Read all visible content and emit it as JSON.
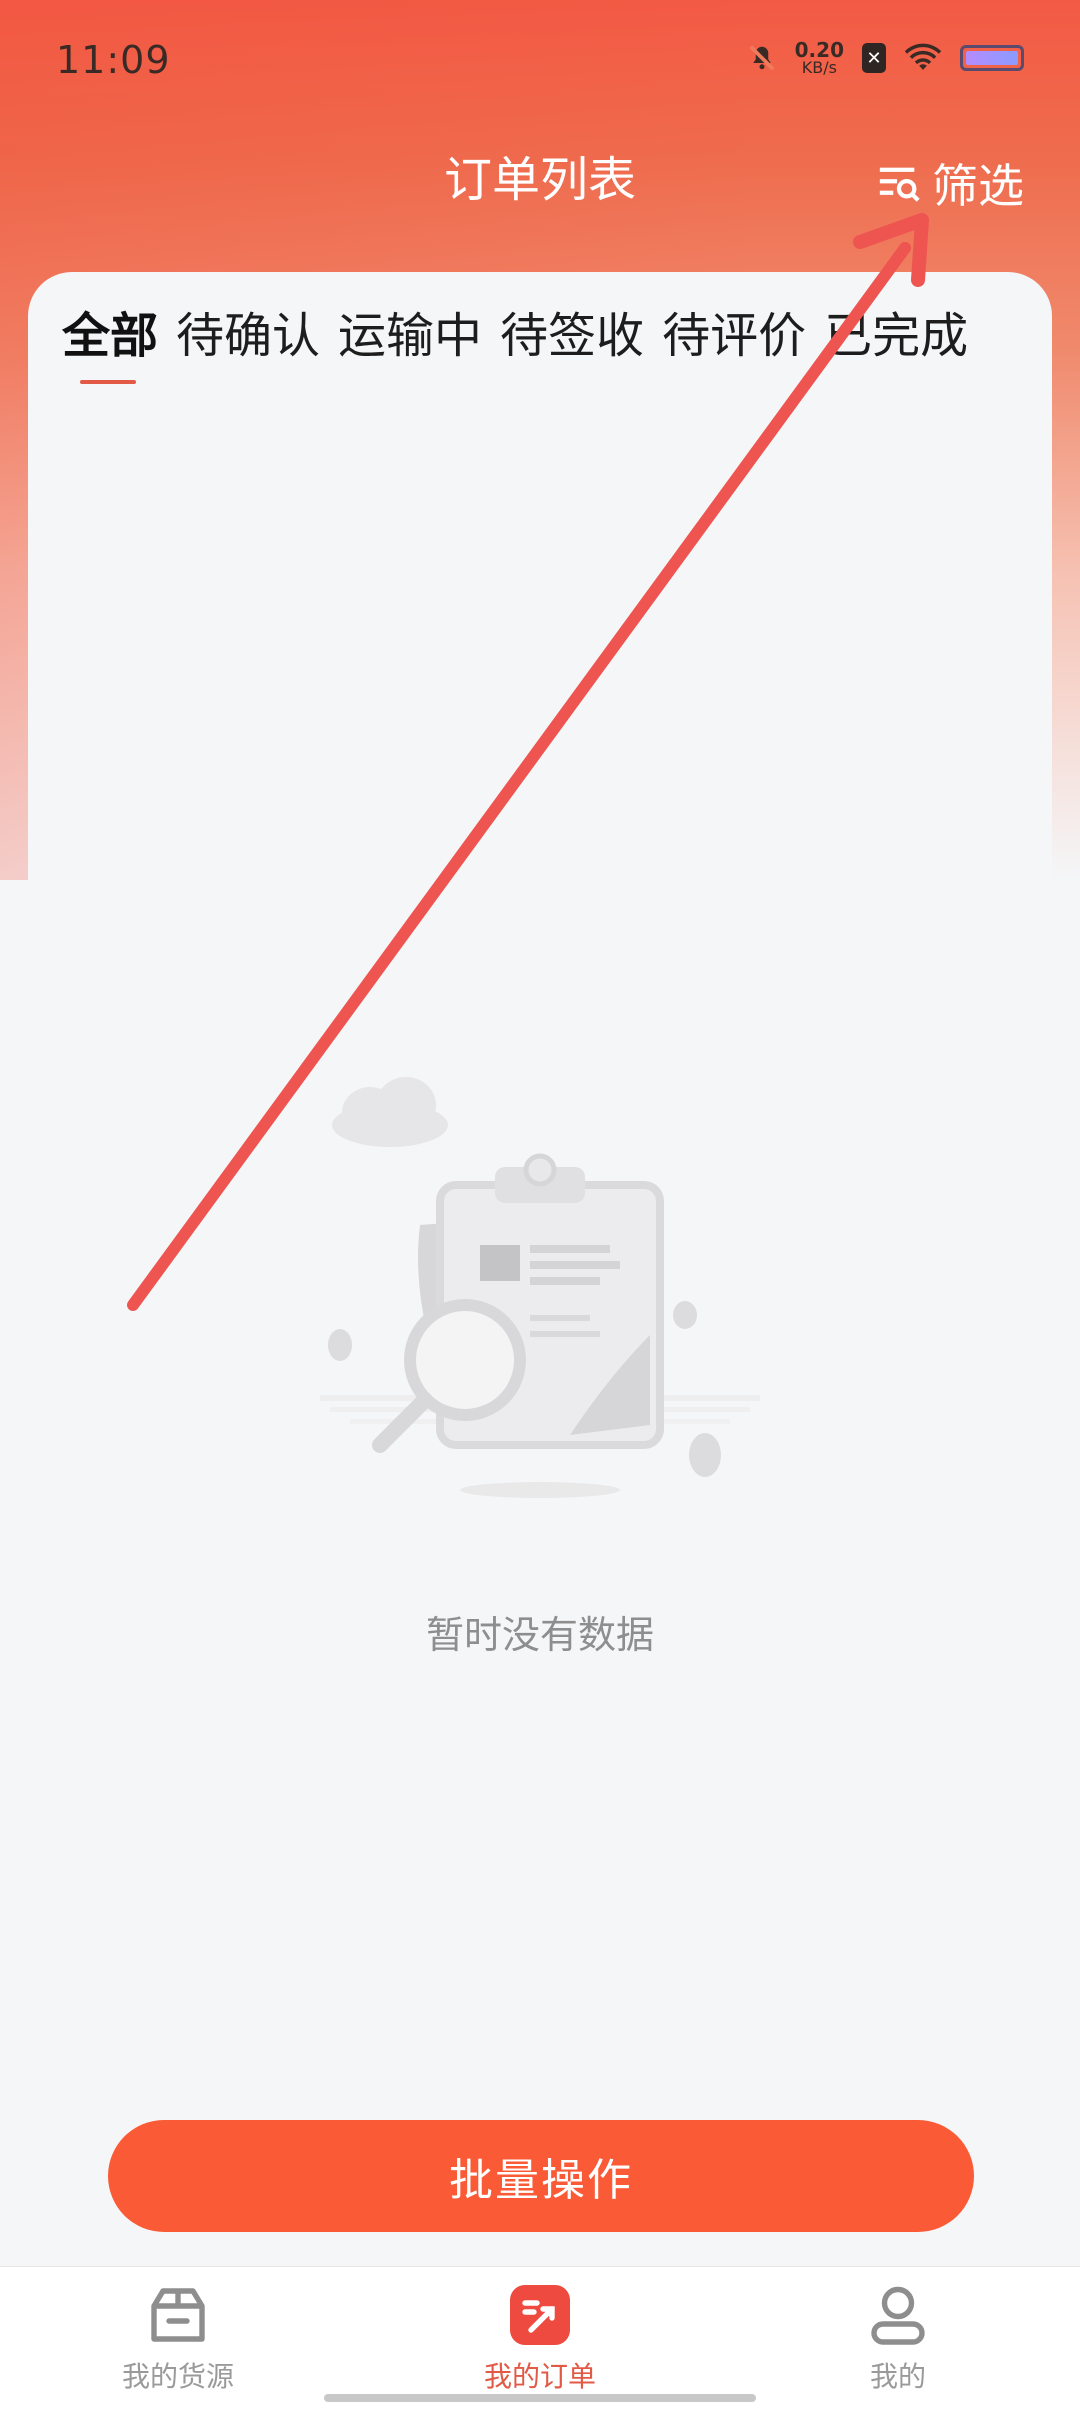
{
  "status_bar": {
    "time": "11:09",
    "net_speed_value": "0.20",
    "net_speed_unit": "KB/s",
    "icons": [
      "mute-bell-icon",
      "sim-disabled-icon",
      "wifi-icon",
      "battery-icon"
    ]
  },
  "header": {
    "title": "订单列表",
    "filter_label": "筛选",
    "filter_icon": "filter-search-icon"
  },
  "tabs": [
    {
      "label": "全部",
      "active": true
    },
    {
      "label": "待确认",
      "active": false
    },
    {
      "label": "运输中",
      "active": false
    },
    {
      "label": "待签收",
      "active": false
    },
    {
      "label": "待评价",
      "active": false
    },
    {
      "label": "已完成",
      "active": false
    }
  ],
  "empty_state": {
    "message": "暂时没有数据",
    "icon": "empty-clipboard-illustration"
  },
  "batch_button": {
    "label": "批量操作"
  },
  "bottom_nav": [
    {
      "label": "我的货源",
      "icon": "box-icon",
      "active": false
    },
    {
      "label": "我的订单",
      "icon": "order-icon",
      "active": true
    },
    {
      "label": "我的",
      "icon": "profile-icon",
      "active": false
    }
  ],
  "colors": {
    "accent": "#fb5a36",
    "active_tab_indicator": "#e25a46",
    "annotation_arrow": "#ee5550"
  }
}
